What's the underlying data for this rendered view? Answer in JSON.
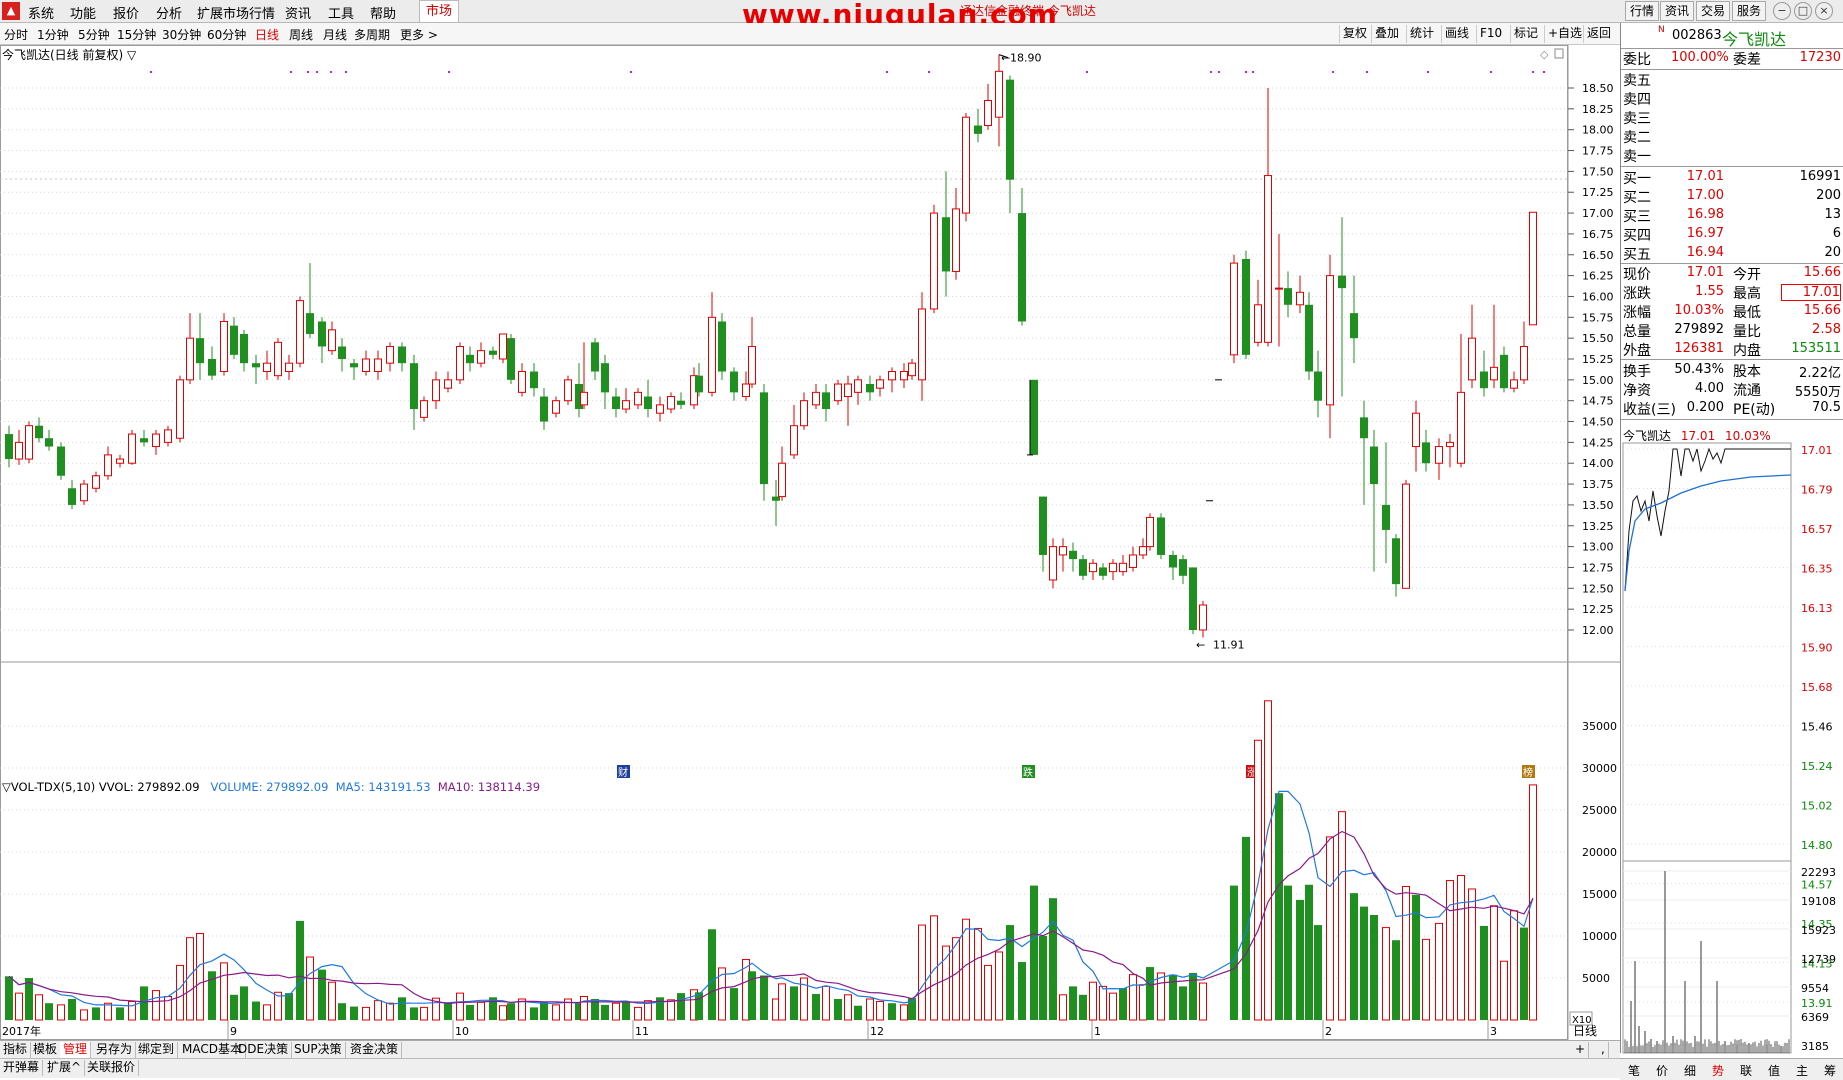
{
  "menu": {
    "items": [
      "系统",
      "功能",
      "报价",
      "分析",
      "扩展市场行情",
      "资讯",
      "工具",
      "帮助"
    ],
    "market": "市场",
    "watermark": "www.niugulan.com",
    "title_red": "通达信金融终端 今飞凯达",
    "right_buttons": [
      "行情",
      "资讯",
      "交易",
      "服务"
    ]
  },
  "periods": [
    "分时",
    "1分钟",
    "5分钟",
    "15分钟",
    "30分钟",
    "60分钟",
    "日线",
    "周线",
    "月线",
    "多周期",
    "更多 >"
  ],
  "active_period": "日线",
  "chart_tools": [
    "复权",
    "叠加",
    "统计",
    "画线",
    "F10",
    "标记",
    "+自选",
    "返回"
  ],
  "chart_caption": "今飞凯达(日线 前复权) ▽",
  "markers": {
    "high": "18.90",
    "low": "11.91"
  },
  "event_icons": [
    "财",
    "跌",
    "涨",
    "榜"
  ],
  "vol_caption": {
    "name": "▽VOL-TDX(5,10)",
    "vvol": "VVOL: 279892.09",
    "volume": "VOLUME: 279892.09",
    "ma5": "MA5: 143191.53",
    "ma10": "MA10: 138114.39"
  },
  "vol_scale_label": "X10",
  "colors": {
    "up": "#e00000",
    "down": "#1f8f1f",
    "ma5": "#1f7ae0",
    "ma10": "#8a1a8a"
  },
  "chart_data": {
    "type": "candlestick",
    "y_axis": [
      "18.50",
      "18.25",
      "18.00",
      "17.75",
      "17.50",
      "17.25",
      "17.00",
      "16.75",
      "16.50",
      "16.25",
      "16.00",
      "15.75",
      "15.50",
      "15.25",
      "15.00",
      "14.75",
      "14.50",
      "14.25",
      "14.00",
      "13.75",
      "13.50",
      "13.25",
      "13.00",
      "12.75",
      "12.50",
      "12.25",
      "12.00"
    ],
    "vol_axis": [
      "35000",
      "30000",
      "25000",
      "20000",
      "15000",
      "10000",
      "5000"
    ],
    "x_labels": [
      "2017年",
      "9",
      "10",
      "11",
      "12",
      "1",
      "2",
      "3"
    ]
  },
  "right_panel": {
    "badge": "N",
    "code": "002863",
    "name": "今飞凯达",
    "weibi_label": "委比",
    "weibi": "100.00%",
    "weicha_label": "委差",
    "weicha": "17230",
    "sell": [
      {
        "label": "卖五"
      },
      {
        "label": "卖四"
      },
      {
        "label": "卖三"
      },
      {
        "label": "卖二"
      },
      {
        "label": "卖一"
      }
    ],
    "buy": [
      {
        "label": "买一",
        "price": "17.01",
        "vol": "16991"
      },
      {
        "label": "买二",
        "price": "17.00",
        "vol": "200"
      },
      {
        "label": "买三",
        "price": "16.98",
        "vol": "13"
      },
      {
        "label": "买四",
        "price": "16.97",
        "vol": "6"
      },
      {
        "label": "买五",
        "price": "16.94",
        "vol": "20"
      }
    ],
    "stats": [
      {
        "l1": "现价",
        "v1": "17.01",
        "c1": "red",
        "l2": "今开",
        "v2": "15.66",
        "c2": "red"
      },
      {
        "l1": "涨跌",
        "v1": "1.55",
        "c1": "red",
        "l2": "最高",
        "v2": "17.01",
        "c2": "red"
      },
      {
        "l1": "涨幅",
        "v1": "10.03%",
        "c1": "red",
        "l2": "最低",
        "v2": "15.66",
        "c2": "red"
      },
      {
        "l1": "总量",
        "v1": "279892",
        "c1": "blk",
        "l2": "量比",
        "v2": "2.58",
        "c2": "red"
      },
      {
        "l1": "外盘",
        "v1": "126381",
        "c1": "red",
        "l2": "内盘",
        "v2": "153511",
        "c2": "green"
      }
    ],
    "stats2": [
      {
        "l1": "换手",
        "v1": "50.43%",
        "c1": "blk",
        "l2": "股本",
        "v2": "2.22亿",
        "c2": "blk"
      },
      {
        "l1": "净资",
        "v1": "4.00",
        "c1": "blk",
        "l2": "流通",
        "v2": "5550万",
        "c2": "blk"
      },
      {
        "l1": "收益(三)",
        "v1": "0.200",
        "c1": "blk",
        "l2": "PE(动)",
        "v2": "70.5",
        "c2": "blk"
      }
    ],
    "mini": {
      "name": "今飞凯达",
      "price": "17.01",
      "pct": "10.03%"
    },
    "mini_axis": [
      "17.01",
      "16.79",
      "16.57",
      "16.35",
      "16.13",
      "15.90",
      "15.68",
      "15.46",
      "15.24",
      "15.02",
      "14.80",
      "14.57",
      "14.35",
      "14.13",
      "13.91"
    ],
    "mini_vol_axis": [
      "22293",
      "19108",
      "15923",
      "12739",
      "9554",
      "6369",
      "3185"
    ],
    "bottom_tabs": [
      "笔",
      "价",
      "细",
      "势",
      "联",
      "值",
      "主",
      "筹"
    ],
    "active_bottom": "势"
  },
  "bottom_tabs1": [
    "指标",
    "模板",
    "管理",
    "另存为",
    "绑定到",
    "MACD基本",
    "DDE决策",
    "SUP决策",
    "资金决策"
  ],
  "active_bottom1": "管理",
  "bottom_tabs2": [
    "开弹幕",
    "扩展^",
    "关联报价"
  ],
  "day_label": "日线"
}
